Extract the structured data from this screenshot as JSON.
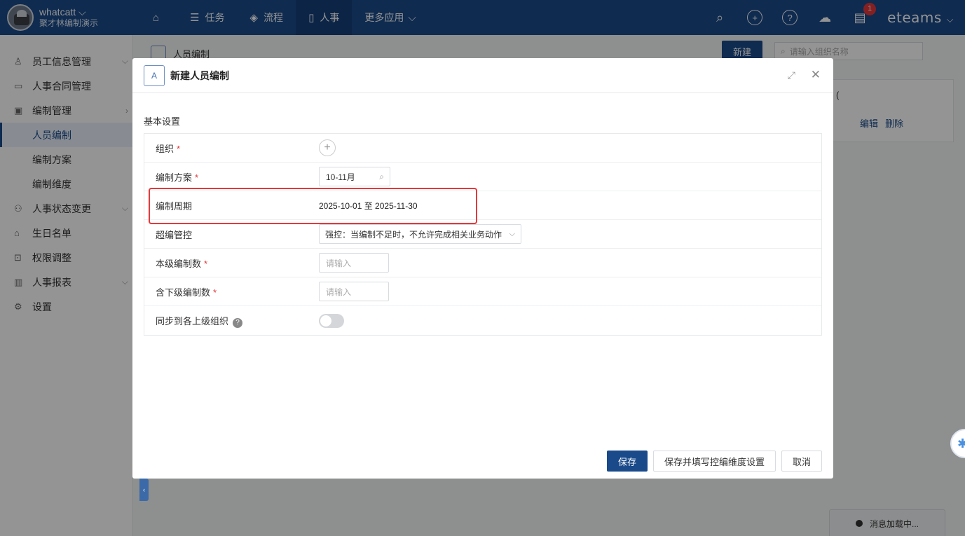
{
  "brand": {
    "user": "whatcatt",
    "org": "聚才林编制演示"
  },
  "nav": {
    "items": [
      {
        "label": "",
        "icon": "home-icon"
      },
      {
        "label": "任务",
        "icon": "list-icon"
      },
      {
        "label": "流程",
        "icon": "layers-icon"
      },
      {
        "label": "人事",
        "icon": "doc-icon",
        "active": true
      },
      {
        "label": "更多应用",
        "icon": "chevron-down-icon"
      }
    ],
    "notification_count": "1",
    "logo": "eteams"
  },
  "sidebar": {
    "items": [
      {
        "label": "员工信息管理",
        "icon": "user-icon"
      },
      {
        "label": "人事合同管理",
        "icon": "contract-icon"
      },
      {
        "label": "编制管理",
        "icon": "plan-icon"
      },
      {
        "label": "人员编制",
        "active": true
      },
      {
        "label": "编制方案"
      },
      {
        "label": "编制维度"
      },
      {
        "label": "人事状态变更",
        "icon": "status-icon"
      },
      {
        "label": "生日名单",
        "icon": "cake-icon"
      },
      {
        "label": "权限调整",
        "icon": "lock-icon"
      },
      {
        "label": "人事报表",
        "icon": "chart-icon"
      },
      {
        "label": "设置",
        "icon": "gear-icon"
      }
    ]
  },
  "page": {
    "title": "人员编制",
    "new_button": "新建",
    "search_placeholder": "请输入组织名称",
    "card_fragment": "(",
    "edit_link": "编辑",
    "delete_link": "删除"
  },
  "modal": {
    "title": "新建人员编制",
    "section": "基本设置",
    "fields": {
      "org": {
        "label": "组织"
      },
      "plan": {
        "label": "编制方案",
        "value": "10-11月"
      },
      "period": {
        "label": "编制周期",
        "value": "2025-10-01 至 2025-11-30"
      },
      "over": {
        "label": "超编管控",
        "value": "强控：当编制不足时，不允许完成相关业务动作"
      },
      "level_count": {
        "label": "本级编制数",
        "placeholder": "请输入"
      },
      "sub_count": {
        "label": "含下级编制数",
        "placeholder": "请输入"
      },
      "sync": {
        "label": "同步到各上级组织"
      }
    },
    "buttons": {
      "save": "保存",
      "save_fill": "保存并填写控编维度设置",
      "cancel": "取消"
    }
  },
  "status": {
    "loading_msg": "消息加载中..."
  },
  "colors": {
    "primary": "#1a4a8a",
    "highlight": "#e5383b"
  }
}
